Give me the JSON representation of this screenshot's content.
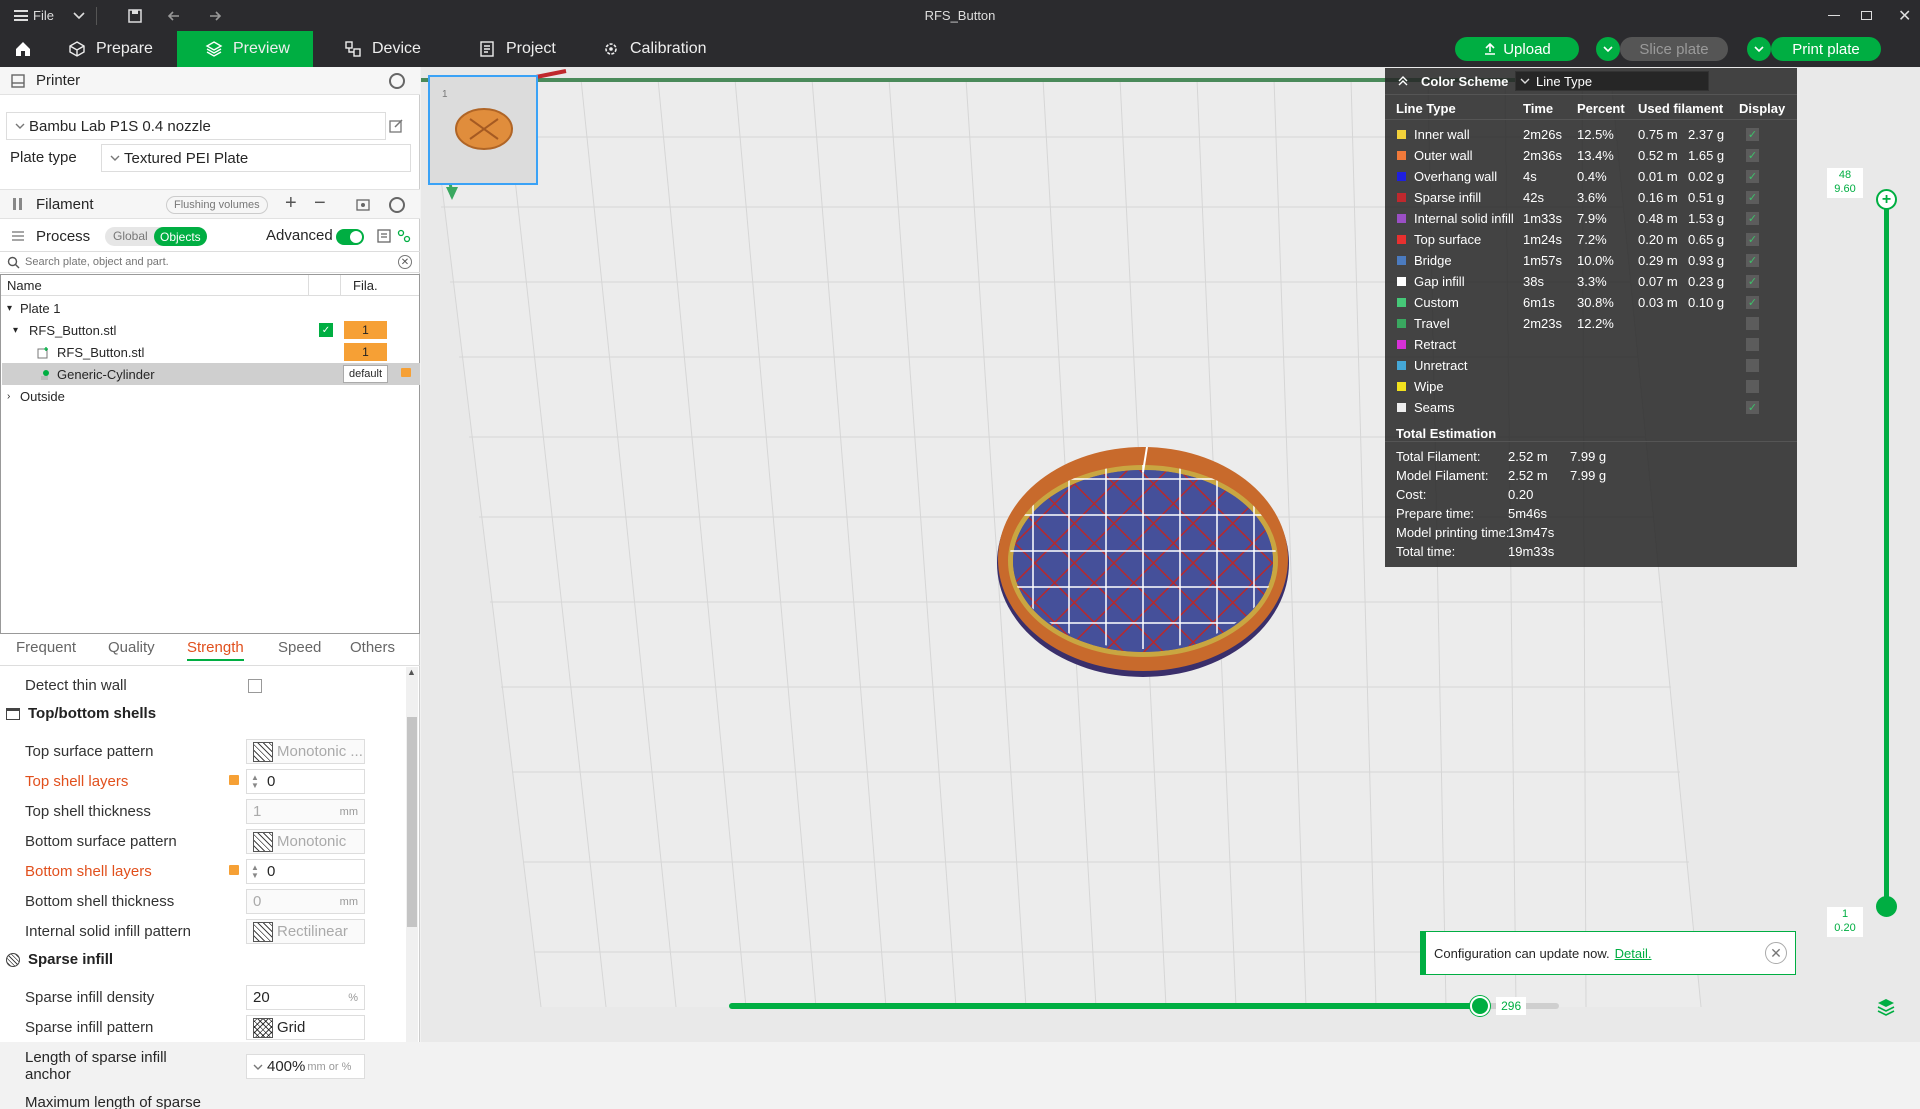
{
  "window": {
    "title": "RFS_Button",
    "file_menu": "File"
  },
  "tabs": [
    {
      "label": "Prepare"
    },
    {
      "label": "Preview"
    },
    {
      "label": "Device"
    },
    {
      "label": "Project"
    },
    {
      "label": "Calibration"
    }
  ],
  "actions": {
    "upload": "Upload",
    "slice_plate": "Slice plate",
    "print_plate": "Print plate"
  },
  "printer": {
    "section_label": "Printer",
    "preset": "Bambu Lab P1S 0.4 nozzle",
    "plate_type_label": "Plate type",
    "plate_type": "Textured PEI Plate"
  },
  "filament": {
    "section_label": "Filament",
    "flushing_volumes": "Flushing volumes"
  },
  "process": {
    "section_label": "Process",
    "global": "Global",
    "objects": "Objects",
    "advanced": "Advanced",
    "search_placeholder": "Search plate, object and part."
  },
  "object_list": {
    "col_name": "Name",
    "col_fila": "Fila.",
    "rows": [
      {
        "name": "Plate 1"
      },
      {
        "name": "RFS_Button.stl",
        "fila": "1"
      },
      {
        "name": "RFS_Button.stl",
        "fila": "1"
      },
      {
        "name": "Generic-Cylinder",
        "fila": "default"
      },
      {
        "name": "Outside"
      }
    ]
  },
  "setting_tabs": [
    "Frequent",
    "Quality",
    "Strength",
    "Speed",
    "Others"
  ],
  "settings": {
    "detect_thin_wall": "Detect thin wall",
    "top_bottom_shells": "Top/bottom shells",
    "top_surface_pattern": {
      "label": "Top surface pattern",
      "value": "Monotonic ..."
    },
    "top_shell_layers": {
      "label": "Top shell layers",
      "value": "0"
    },
    "top_shell_thickness": {
      "label": "Top shell thickness",
      "value": "1",
      "unit": "mm"
    },
    "bottom_surface_pattern": {
      "label": "Bottom surface pattern",
      "value": "Monotonic"
    },
    "bottom_shell_layers": {
      "label": "Bottom shell layers",
      "value": "0"
    },
    "bottom_shell_thickness": {
      "label": "Bottom shell thickness",
      "value": "0",
      "unit": "mm"
    },
    "internal_solid_infill_pattern": {
      "label": "Internal solid infill pattern",
      "value": "Rectilinear"
    },
    "sparse_infill": "Sparse infill",
    "sparse_infill_density": {
      "label": "Sparse infill density",
      "value": "20",
      "unit": "%"
    },
    "sparse_infill_pattern": {
      "label": "Sparse infill pattern",
      "value": "Grid"
    },
    "sparse_infill_anchor": {
      "label1": "Length of sparse infill",
      "label2": "anchor",
      "value": "400%",
      "unit": "mm or %"
    },
    "max_sparse": {
      "label": "Maximum length of sparse"
    }
  },
  "plate_thumb_num": "1",
  "legend": {
    "header": "Color Scheme",
    "scheme": "Line Type",
    "columns": [
      "Line Type",
      "Time",
      "Percent",
      "Used filament",
      "Display"
    ],
    "rows": [
      {
        "name": "Inner wall",
        "color": "#f2d13a",
        "time": "2m26s",
        "percent": "12.5%",
        "length": "0.75 m",
        "weight": "2.37 g",
        "display": true
      },
      {
        "name": "Outer wall",
        "color": "#f0793a",
        "time": "2m36s",
        "percent": "13.4%",
        "length": "0.52 m",
        "weight": "1.65 g",
        "display": true
      },
      {
        "name": "Overhang wall",
        "color": "#1f1fde",
        "time": "4s",
        "percent": "0.4%",
        "length": "0.01 m",
        "weight": "0.02 g",
        "display": true
      },
      {
        "name": "Sparse infill",
        "color": "#c0282d",
        "time": "42s",
        "percent": "3.6%",
        "length": "0.16 m",
        "weight": "0.51 g",
        "display": true
      },
      {
        "name": "Internal solid infill",
        "color": "#9b4fc5",
        "time": "1m33s",
        "percent": "7.9%",
        "length": "0.48 m",
        "weight": "1.53 g",
        "display": true
      },
      {
        "name": "Top surface",
        "color": "#e8302f",
        "time": "1m24s",
        "percent": "7.2%",
        "length": "0.20 m",
        "weight": "0.65 g",
        "display": true
      },
      {
        "name": "Bridge",
        "color": "#4b7bbf",
        "time": "1m57s",
        "percent": "10.0%",
        "length": "0.29 m",
        "weight": "0.93 g",
        "display": true
      },
      {
        "name": "Gap infill",
        "color": "#ffffff",
        "time": "38s",
        "percent": "3.3%",
        "length": "0.07 m",
        "weight": "0.23 g",
        "display": true
      },
      {
        "name": "Custom",
        "color": "#46c878",
        "time": "6m1s",
        "percent": "30.8%",
        "length": "0.03 m",
        "weight": "0.10 g",
        "display": true
      },
      {
        "name": "Travel",
        "color": "#3aa860",
        "time": "2m23s",
        "percent": "12.2%",
        "length": "",
        "weight": "",
        "display": false
      },
      {
        "name": "Retract",
        "color": "#d831d8",
        "time": "",
        "percent": "",
        "length": "",
        "weight": "",
        "display": false
      },
      {
        "name": "Unretract",
        "color": "#45a8d8",
        "time": "",
        "percent": "",
        "length": "",
        "weight": "",
        "display": false
      },
      {
        "name": "Wipe",
        "color": "#f2e21e",
        "time": "",
        "percent": "",
        "length": "",
        "weight": "",
        "display": false
      },
      {
        "name": "Seams",
        "color": "#eeeeee",
        "time": "",
        "percent": "",
        "length": "",
        "weight": "",
        "display": true
      }
    ],
    "total_title": "Total Estimation",
    "totals": [
      {
        "label": "Total Filament:",
        "v1": "2.52 m",
        "v2": "7.99 g"
      },
      {
        "label": "Model Filament:",
        "v1": "2.52 m",
        "v2": "7.99 g"
      },
      {
        "label": "Cost:",
        "v1": "0.20",
        "v2": ""
      },
      {
        "label": "Prepare time:",
        "v1": "5m46s",
        "v2": ""
      },
      {
        "label": "Model printing time:",
        "v1": "13m47s",
        "v2": ""
      },
      {
        "label": "Total time:",
        "v1": "19m33s",
        "v2": ""
      }
    ]
  },
  "layer_slider": {
    "top_layer": "48",
    "top_height": "9.60",
    "bottom_layer": "1",
    "bottom_height": "0.20"
  },
  "move_slider": {
    "value": "296",
    "fraction": 0.905
  },
  "notification": {
    "text": "Configuration can update now.",
    "link": "Detail."
  }
}
